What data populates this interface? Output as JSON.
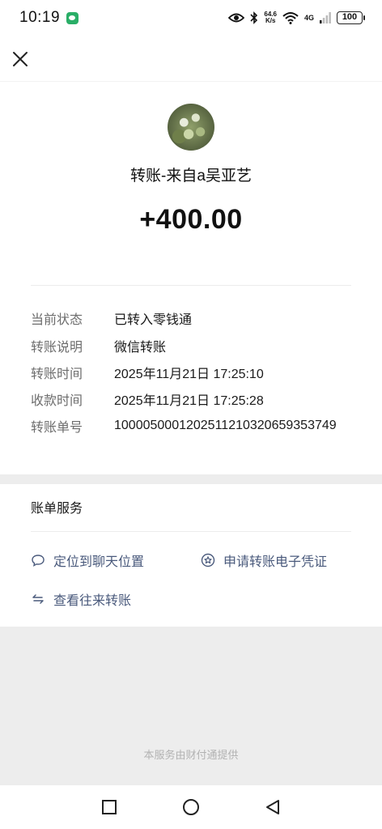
{
  "status_bar": {
    "time": "10:19",
    "speed_value": "64.6",
    "speed_unit": "K/s",
    "network": "4G",
    "battery": "100"
  },
  "icons": {
    "close": "close-icon",
    "chat": "chat-bubble-icon",
    "receipt": "badge-star-icon",
    "transfer": "swap-arrows-icon",
    "eye": "eye-icon",
    "bluetooth": "bluetooth-icon",
    "wifi": "wifi-icon",
    "signal": "signal-icon"
  },
  "header": {
    "title": "转账-来自a吴亚艺",
    "amount": "+400.00"
  },
  "details": [
    {
      "label": "当前状态",
      "value": "已转入零钱通"
    },
    {
      "label": "转账说明",
      "value": "微信转账"
    },
    {
      "label": "转账时间",
      "value": "2025年11月21日 17:25:10"
    },
    {
      "label": "收款时间",
      "value": "2025年11月21日 17:25:28"
    },
    {
      "label": "转账单号",
      "value": "1000050001202511210320659353749"
    }
  ],
  "services": {
    "title": "账单服务",
    "locate_chat": "定位到聊天位置",
    "apply_voucher": "申请转账电子凭证",
    "view_transfers": "查看往来转账"
  },
  "footer": {
    "provider": "本服务由财付通提供"
  },
  "colors": {
    "link": "#4a5a7c",
    "wechat_green": "#2aae67",
    "background": "#ededed"
  }
}
